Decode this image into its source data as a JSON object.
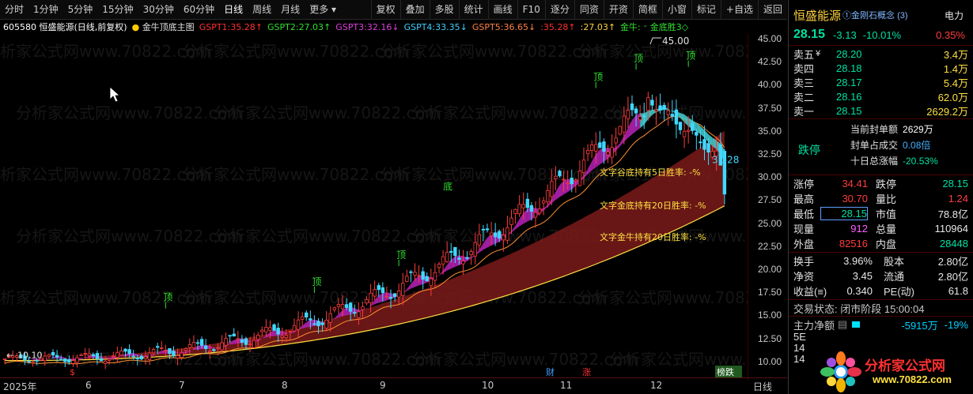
{
  "toolbar": {
    "left_items": [
      "分时",
      "1分钟",
      "5分钟",
      "15分钟",
      "30分钟",
      "60分钟",
      "日线",
      "周线",
      "月线",
      "更多 ▾"
    ],
    "active": "日线",
    "right_items": [
      "复权",
      "叠加",
      "多股",
      "统计",
      "画线",
      "F10",
      "逐分",
      "同资",
      "开资",
      "简框",
      "小窗",
      "标记",
      "+自选",
      "返回"
    ]
  },
  "chart_header": {
    "code_title": "605580 恒盛能源(日线,前复权)",
    "indicator": "金牛顶底主图",
    "gspt": [
      {
        "label": "GSPT1:",
        "value": "35.28",
        "arrow": "↑",
        "color": "#ff3030"
      },
      {
        "label": "GSPT2:",
        "value": "27.03",
        "arrow": "↑",
        "color": "#30e030"
      },
      {
        "label": "GSPT3:",
        "value": "32.16",
        "arrow": "↓",
        "color": "#e040e0"
      },
      {
        "label": "GSPT4:",
        "value": "33.35",
        "arrow": "↓",
        "color": "#40d0ff"
      },
      {
        "label": "GSPT5:",
        "value": "36.65",
        "arrow": "↓",
        "color": "#ff8040"
      },
      {
        "label": ":",
        "value": "35.28",
        "arrow": "↑",
        "color": "#ff3030"
      },
      {
        "label": ":",
        "value": "27.03",
        "arrow": "↑",
        "color": "#ffd040"
      }
    ],
    "extra": [
      "金牛:",
      "-",
      "金底胜3◇"
    ]
  },
  "chart": {
    "price_ticks": [
      "45.00",
      "42.50",
      "40.00",
      "37.50",
      "35.00",
      "32.50",
      "30.00",
      "27.50",
      "25.00",
      "22.50",
      "20.00",
      "17.50",
      "15.00",
      "12.50",
      "10.00"
    ],
    "high_label": "45.00",
    "last_price_label": "31.28",
    "low_label": "10.10",
    "low_label_prefix": "←",
    "top_labels": [
      "顶",
      "顶",
      "顶",
      "顶",
      "顶",
      "顶"
    ],
    "bottom_label": "底",
    "annotations": [
      "文字谷底持有5日胜率:  -%",
      "文字金底持有20日胜率:  -%",
      "文字金牛持有20日胜率:  -%"
    ],
    "watermark": "分析家公式网www.70822.com",
    "bottom_markers": [
      "$",
      "财",
      "涨",
      "榜跌"
    ],
    "x_ticks": [
      "2025年",
      "6",
      "7",
      "8",
      "9",
      "10",
      "11",
      "12"
    ],
    "x_axis_right": "日线"
  },
  "panel": {
    "stock_name": "恒盛能源",
    "concept": "①金刚石概念 (3)",
    "tag": "电力",
    "price": "28.15",
    "change": "-3.13",
    "change_pct": "-10.01%",
    "tag_pct": "0.35%",
    "asks": [
      {
        "label": "卖五",
        "sym": "¥",
        "price": "28.20",
        "vol": "3.4万"
      },
      {
        "label": "卖四",
        "sym": "",
        "price": "28.18",
        "vol": "1.4万"
      },
      {
        "label": "卖三",
        "sym": "",
        "price": "28.17",
        "vol": "5.4万"
      },
      {
        "label": "卖二",
        "sym": "",
        "price": "28.16",
        "vol": "62.0万"
      },
      {
        "label": "卖一",
        "sym": "",
        "price": "28.15",
        "vol": "2629.2万"
      }
    ],
    "limit_status": "跌停",
    "seal_info": [
      {
        "label": "当前封单额",
        "value": "2629万"
      },
      {
        "label": "封单占成交",
        "value": "0.08倍"
      },
      {
        "label": "十日总涨幅",
        "value": "-20.53%"
      }
    ],
    "stats": [
      {
        "l1": "涨停",
        "v1": "34.41",
        "c1": "up",
        "l2": "跌停",
        "v2": "28.15",
        "c2": "down"
      },
      {
        "l1": "最高",
        "v1": "30.70",
        "c1": "up",
        "l2": "量比",
        "v2": "1.24",
        "c2": "up"
      },
      {
        "l1": "最低",
        "v1": "28.15",
        "c1": "down",
        "l2": "市值",
        "v2": "78.8亿",
        "c2": "white"
      },
      {
        "l1": "现量",
        "v1": "912",
        "c1": "mag",
        "l2": "总量",
        "v2": "110964",
        "c2": "white"
      },
      {
        "l1": "外盘",
        "v1": "82516",
        "c1": "up",
        "l2": "内盘",
        "v2": "28448",
        "c2": "down"
      }
    ],
    "stats2": [
      {
        "l1": "换手",
        "v1": "3.96%",
        "l2": "股本",
        "v2": "2.80亿"
      },
      {
        "l1": "净资",
        "v1": "3.45",
        "l2": "流通",
        "v2": "2.80亿"
      },
      {
        "l1": "收益(≡)",
        "v1": "0.340",
        "l2": "PE(动)",
        "v2": "61.8"
      }
    ],
    "trade_status": "交易状态: 闭市阶段 15:00:04",
    "main_flow_label": "主力净额",
    "main_flow_value": "-5915万",
    "main_flow_pct": "-19%",
    "bottom_rows": [
      "5E",
      "14",
      "14"
    ],
    "logo_text": "分析家公式网",
    "logo_url": "www.70822.com"
  }
}
